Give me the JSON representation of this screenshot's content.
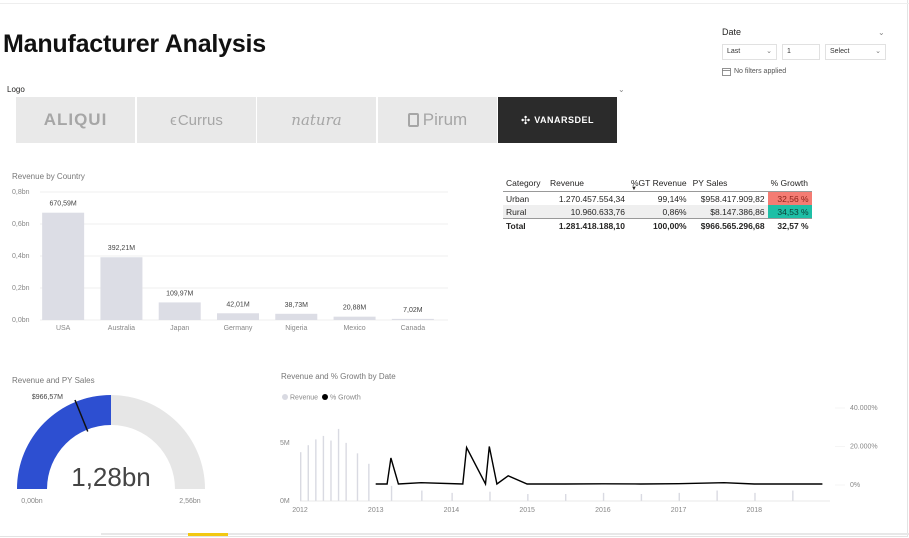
{
  "page": {
    "title": "Manufacturer Analysis"
  },
  "date_slicer": {
    "label": "Date",
    "period_value": "Last",
    "count_value": "1",
    "unit_placeholder": "Select",
    "filter_status": "No filters applied"
  },
  "logo_slicer": {
    "label": "Logo",
    "items": [
      "ALIQUI",
      "Currus",
      "natura",
      "Pirum",
      "VANARSDEL"
    ],
    "selected": "VANARSDEL"
  },
  "revenue_by_country": {
    "title": "Revenue by Country",
    "chart_data": {
      "type": "bar",
      "categories": [
        "USA",
        "Australia",
        "Japan",
        "Germany",
        "Nigeria",
        "Mexico",
        "Canada"
      ],
      "values": [
        670.59,
        392.21,
        109.97,
        42.01,
        38.73,
        20.88,
        7.02
      ],
      "data_labels": [
        "670,59M",
        "392,21M",
        "109,97M",
        "42,01M",
        "38,73M",
        "20,88M",
        "7,02M"
      ],
      "y_ticks": [
        "0,8bn",
        "0,6bn",
        "0,4bn",
        "0,2bn",
        "0,0bn"
      ],
      "ylim": [
        0,
        800
      ],
      "unit": "M",
      "grid": true,
      "color": "#dcdde5"
    }
  },
  "category_matrix": {
    "headers": [
      "Category",
      "Revenue",
      "%GT Revenue",
      "PY Sales",
      "% Growth"
    ],
    "rows": [
      [
        "Urban",
        "1.270.457.554,34",
        "99,14%",
        "$958.417.909,82",
        "32,56 %"
      ],
      [
        "Rural",
        "10.960.633,76",
        "0,86%",
        "$8.147.386,86",
        "34,53 %"
      ]
    ],
    "total": [
      "Total",
      "1.281.418.188,10",
      "100,00%",
      "$966.565.296,68",
      "32,57 %"
    ],
    "growth_colors": [
      "#f47c73",
      "#1ebfa6"
    ]
  },
  "gauge": {
    "title": "Revenue and PY Sales",
    "value_label": "1,28bn",
    "target_label": "$966,57M",
    "min_label": "0,00bn",
    "max_label": "2,56bn",
    "chart_data": {
      "type": "gauge",
      "value": 1.28,
      "target": 0.96657,
      "min": 0,
      "max": 2.56,
      "unit": "bn",
      "fill_color": "#2d4fd1",
      "track_color": "#e6e6e6"
    }
  },
  "revenue_growth_by_date": {
    "title": "Revenue and % Growth by Date",
    "legend": [
      {
        "name": "Revenue",
        "color": "#d9dae2"
      },
      {
        "name": "% Growth",
        "color": "#000000"
      }
    ],
    "chart_data": {
      "type": "line",
      "x_ticks": [
        "2012",
        "2013",
        "2014",
        "2015",
        "2016",
        "2017",
        "2018"
      ],
      "y_left_ticks": [
        "5M",
        "0M"
      ],
      "y_right_ticks": [
        "40.000%",
        "20.000%",
        "0%"
      ],
      "series": [
        {
          "name": "Revenue",
          "style": "bar",
          "color": "#d9dae2",
          "x": [
            2012.0,
            2012.1,
            2012.2,
            2012.3,
            2012.4,
            2012.5,
            2012.6,
            2012.75,
            2012.9,
            2013.2,
            2013.6,
            2014.0,
            2014.5,
            2015.0,
            2015.5,
            2016.0,
            2016.5,
            2017.0,
            2017.5,
            2018.0,
            2018.5
          ],
          "values": [
            4.2,
            4.8,
            5.3,
            5.6,
            5.2,
            6.2,
            5.0,
            4.1,
            3.2,
            1.3,
            0.9,
            0.7,
            0.8,
            0.6,
            0.6,
            0.7,
            0.6,
            0.7,
            0.9,
            0.7,
            0.9
          ]
        },
        {
          "name": "% Growth",
          "style": "line",
          "color": "#000000",
          "x": [
            2013.0,
            2013.15,
            2013.2,
            2013.3,
            2013.6,
            2014.15,
            2014.2,
            2014.45,
            2014.5,
            2014.6,
            2014.75,
            2015.0,
            2015.5,
            2016.0,
            2016.5,
            2017.0,
            2017.6,
            2018.0,
            2018.9
          ],
          "values": [
            500,
            500,
            14000,
            500,
            1200,
            500,
            19500,
            500,
            20000,
            500,
            4800,
            500,
            500,
            600,
            500,
            700,
            1200,
            500,
            500
          ],
          "range": [
            0,
            40000
          ]
        }
      ]
    }
  }
}
